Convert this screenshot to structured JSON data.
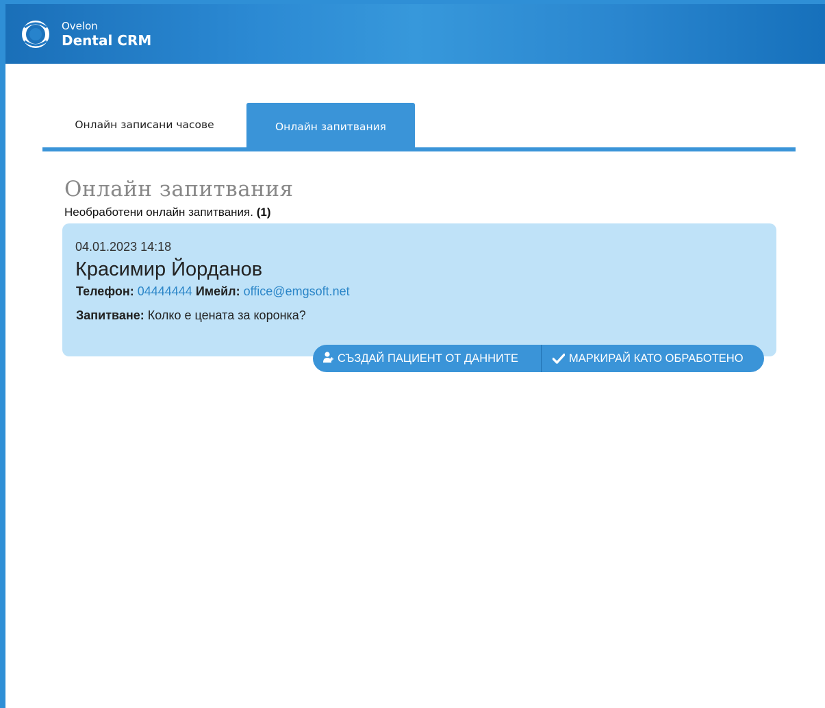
{
  "header": {
    "brand_small": "Ovelon",
    "brand_big": "Dental CRM",
    "logo_icon": "ovelon-logo-icon"
  },
  "tabs": [
    {
      "label": "Онлайн записани часове",
      "active": false
    },
    {
      "label": "Онлайн запитвания",
      "active": true
    }
  ],
  "section": {
    "title": "Онлайн запитвания",
    "subtitle": "Необработени онлайн запитвания.",
    "count": "(1)"
  },
  "inquiry": {
    "datetime": "04.01.2023 14:18",
    "name": "Красимир Йорданов",
    "phone_label": "Телефон:",
    "phone": "04444444",
    "email_label": "Имейл:",
    "email": "office@emgsoft.net",
    "question_label": "Запитване:",
    "question": "Колко е цената за коронка?"
  },
  "actions": {
    "create_patient": "СЪЗДАЙ ПАЦИЕНТ ОТ ДАННИТЕ",
    "create_patient_icon": "user-add-icon",
    "mark_processed": "МАРКИРАЙ КАТО ОБРАБОТЕНО",
    "mark_processed_icon": "check-icon"
  },
  "colors": {
    "accent": "#3a94d8",
    "card_bg": "#bfe2f8",
    "link": "#2b86c8",
    "title_gray": "#888888"
  }
}
